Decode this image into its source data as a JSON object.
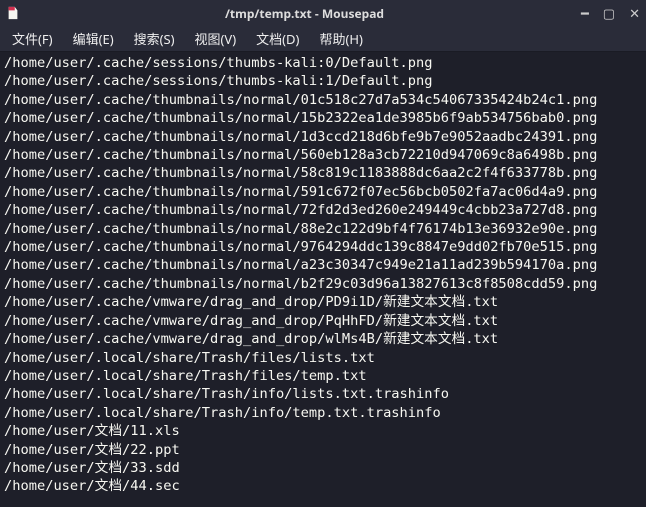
{
  "window": {
    "title": "/tmp/temp.txt - Mousepad"
  },
  "menubar": {
    "file": "文件(F)",
    "edit": "编辑(E)",
    "search": "搜索(S)",
    "view": "视图(V)",
    "doc": "文档(D)",
    "help": "帮助(H)"
  },
  "content_lines": [
    "/home/user/.cache/sessions/thumbs-kali:0/Default.png",
    "/home/user/.cache/sessions/thumbs-kali:1/Default.png",
    "/home/user/.cache/thumbnails/normal/01c518c27d7a534c54067335424b24c1.png",
    "/home/user/.cache/thumbnails/normal/15b2322ea1de3985b6f9ab534756bab0.png",
    "/home/user/.cache/thumbnails/normal/1d3ccd218d6bfe9b7e9052aadbc24391.png",
    "/home/user/.cache/thumbnails/normal/560eb128a3cb72210d947069c8a6498b.png",
    "/home/user/.cache/thumbnails/normal/58c819c1183888dc6aa2c2f4f633778b.png",
    "/home/user/.cache/thumbnails/normal/591c672f07ec56bcb0502fa7ac06d4a9.png",
    "/home/user/.cache/thumbnails/normal/72fd2d3ed260e249449c4cbb23a727d8.png",
    "/home/user/.cache/thumbnails/normal/88e2c122d9bf4f76174b13e36932e90e.png",
    "/home/user/.cache/thumbnails/normal/9764294ddc139c8847e9dd02fb70e515.png",
    "/home/user/.cache/thumbnails/normal/a23c30347c949e21a11ad239b594170a.png",
    "/home/user/.cache/thumbnails/normal/b2f29c03d96a13827613c8f8508cdd59.png",
    "/home/user/.cache/vmware/drag_and_drop/PD9i1D/新建文本文档.txt",
    "/home/user/.cache/vmware/drag_and_drop/PqHhFD/新建文本文档.txt",
    "/home/user/.cache/vmware/drag_and_drop/wlMs4B/新建文本文档.txt",
    "/home/user/.local/share/Trash/files/lists.txt",
    "/home/user/.local/share/Trash/files/temp.txt",
    "/home/user/.local/share/Trash/info/lists.txt.trashinfo",
    "/home/user/.local/share/Trash/info/temp.txt.trashinfo",
    "/home/user/文档/11.xls",
    "/home/user/文档/22.ppt",
    "/home/user/文档/33.sdd",
    "/home/user/文档/44.sec"
  ]
}
